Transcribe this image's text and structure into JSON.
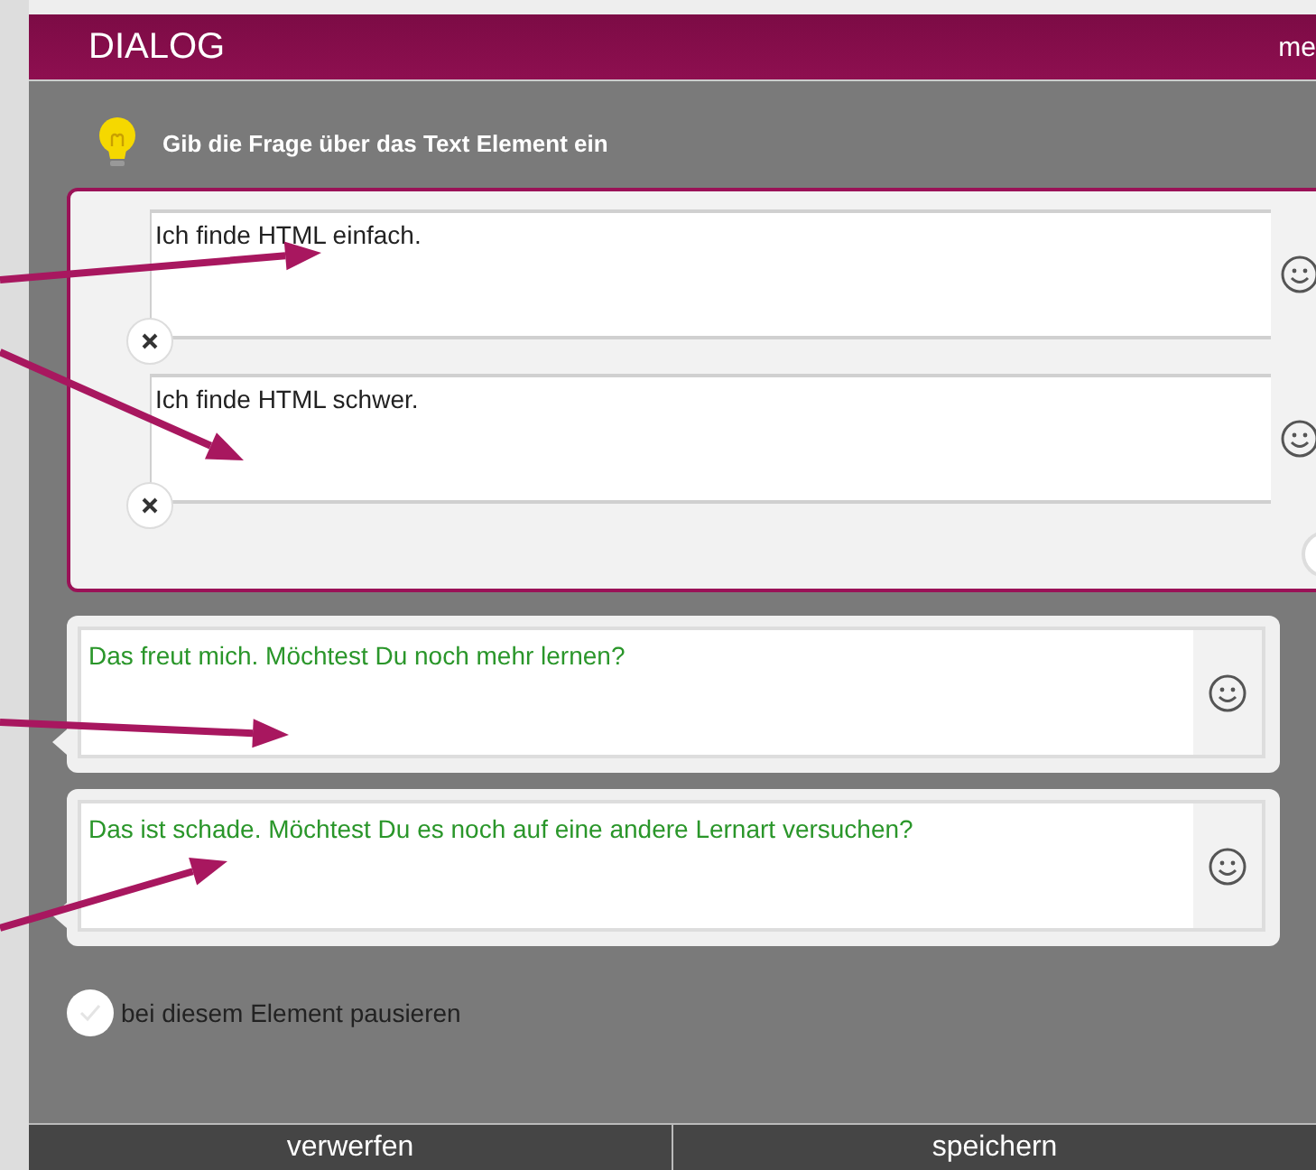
{
  "header": {
    "title": "DIALOG",
    "right_text": "me"
  },
  "hint": {
    "text": "Gib die Frage über das Text Element ein"
  },
  "answers": [
    {
      "value": "Ich finde HTML einfach."
    },
    {
      "value": "Ich finde HTML schwer."
    }
  ],
  "responses": [
    {
      "value": "Das freut mich. Möchtest Du noch mehr lernen?"
    },
    {
      "value": "Das ist schade. Möchtest Du es noch auf eine andere Lernart versuchen?"
    }
  ],
  "pause_option": {
    "label": "bei diesem Element pausieren",
    "checked": false
  },
  "buttons": [
    {
      "label": "verwerfen"
    },
    {
      "label": "speichern"
    }
  ]
}
